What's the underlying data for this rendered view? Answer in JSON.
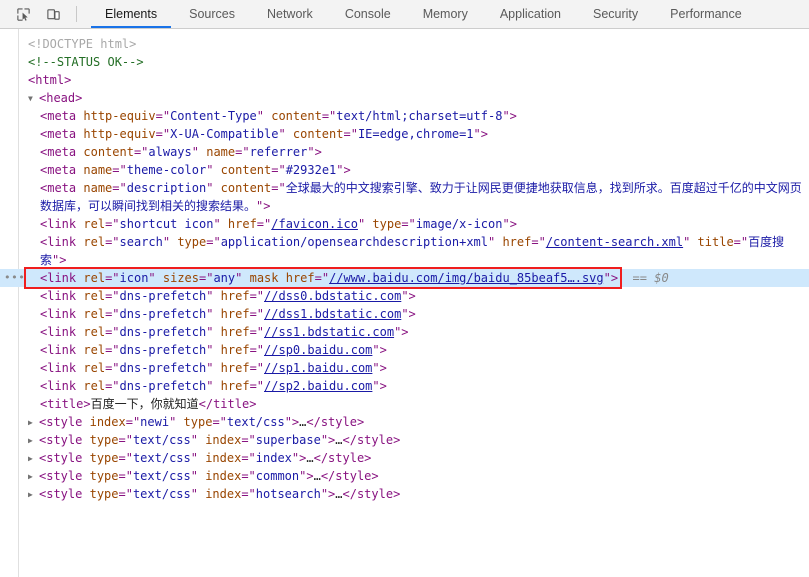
{
  "toolbar": {
    "inspect_icon": "inspect-cursor-icon",
    "device_icon": "device-toolbar-icon",
    "tabs": [
      {
        "label": "Elements",
        "active": true
      },
      {
        "label": "Sources",
        "active": false
      },
      {
        "label": "Network",
        "active": false
      },
      {
        "label": "Console",
        "active": false
      },
      {
        "label": "Memory",
        "active": false
      },
      {
        "label": "Application",
        "active": false
      },
      {
        "label": "Security",
        "active": false
      },
      {
        "label": "Performance",
        "active": false
      }
    ],
    "active_tab_underline_color": "#1a73e8"
  },
  "dom_tree": {
    "selected_row_background": "#cfe8fc",
    "annotation_box_color": "#f01e1e",
    "selected_marker": "== $0",
    "gutter_dots": "•••",
    "triangle_expanded": "▼",
    "triangle_collapsed": "▶",
    "lines": {
      "doctype": "<!DOCTYPE html>",
      "status_comment": "<!--STATUS OK-->",
      "html_open": "<html>",
      "head_open": "<head>",
      "meta_content_type": {
        "tag": "meta",
        "attr1": "http-equiv",
        "val1": "Content-Type",
        "attr2": "content",
        "val2": "text/html;charset=utf-8"
      },
      "meta_ua_compatible": {
        "tag": "meta",
        "attr1": "http-equiv",
        "val1": "X-UA-Compatible",
        "attr2": "content",
        "val2": "IE=edge,chrome=1"
      },
      "meta_referrer": {
        "tag": "meta",
        "attr1": "content",
        "val1": "always",
        "attr2": "name",
        "val2": "referrer"
      },
      "meta_theme_color": {
        "tag": "meta",
        "attr1": "name",
        "val1": "theme-color",
        "attr2": "content",
        "val2": "#2932e1"
      },
      "meta_description": {
        "tag": "meta",
        "attr1": "name",
        "val1": "description",
        "attr2": "content",
        "val2": "全球最大的中文搜索引擎、致力于让网民更便捷地获取信息，找到所求。百度超过千亿的中文网页数据库，可以瞬间找到相关的搜索结果。"
      },
      "link_shortcut_icon": {
        "tag": "link",
        "attr1": "rel",
        "val1": "shortcut icon",
        "attr2": "href",
        "val2": "/favicon.ico",
        "attr3": "type",
        "val3": "image/x-icon"
      },
      "link_search": {
        "tag": "link",
        "attr1": "rel",
        "val1": "search",
        "attr2": "type",
        "val2": "application/opensearchdescription+xml",
        "attr3": "href",
        "val3": "/content-search.xml",
        "attr4": "title",
        "val4": "百度搜索"
      },
      "link_icon_selected": {
        "tag": "link",
        "attr1": "rel",
        "val1": "icon",
        "attr2": "sizes",
        "val2": "any",
        "attr3": "mask",
        "attr4": "href",
        "val4": "//www.baidu.com/img/baidu_85beaf5….svg"
      },
      "dns_prefetch": [
        {
          "tag": "link",
          "attr1": "rel",
          "val1": "dns-prefetch",
          "attr2": "href",
          "val2": "//dss0.bdstatic.com"
        },
        {
          "tag": "link",
          "attr1": "rel",
          "val1": "dns-prefetch",
          "attr2": "href",
          "val2": "//dss1.bdstatic.com"
        },
        {
          "tag": "link",
          "attr1": "rel",
          "val1": "dns-prefetch",
          "attr2": "href",
          "val2": "//ss1.bdstatic.com"
        },
        {
          "tag": "link",
          "attr1": "rel",
          "val1": "dns-prefetch",
          "attr2": "href",
          "val2": "//sp0.baidu.com"
        },
        {
          "tag": "link",
          "attr1": "rel",
          "val1": "dns-prefetch",
          "attr2": "href",
          "val2": "//sp1.baidu.com"
        },
        {
          "tag": "link",
          "attr1": "rel",
          "val1": "dns-prefetch",
          "attr2": "href",
          "val2": "//sp2.baidu.com"
        }
      ],
      "title": {
        "tag": "title",
        "text": "百度一下，你就知道"
      },
      "styles": [
        {
          "tag": "style",
          "attr1": "index",
          "val1": "newi",
          "attr2": "type",
          "val2": "text/css",
          "ellipsis": "…"
        },
        {
          "tag": "style",
          "attr1": "type",
          "val1": "text/css",
          "attr2": "index",
          "val2": "superbase",
          "ellipsis": "…"
        },
        {
          "tag": "style",
          "attr1": "type",
          "val1": "text/css",
          "attr2": "index",
          "val2": "index",
          "ellipsis": "…"
        },
        {
          "tag": "style",
          "attr1": "type",
          "val1": "text/css",
          "attr2": "index",
          "val2": "common",
          "ellipsis": "…"
        },
        {
          "tag": "style",
          "attr1": "type",
          "val1": "text/css",
          "attr2": "index",
          "val2": "hotsearch",
          "ellipsis": "…"
        }
      ]
    }
  }
}
